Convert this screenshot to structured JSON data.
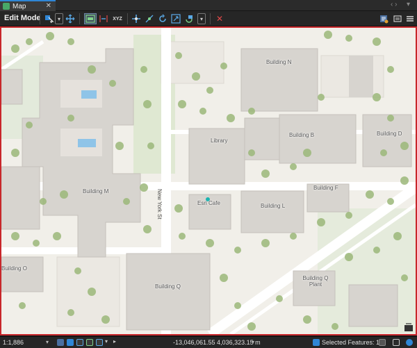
{
  "tab": {
    "title": "Map",
    "close": "✕"
  },
  "window": {
    "nav": "‹ ›",
    "menu": "▾"
  },
  "toolbar": {
    "mode_label": "Edit Mode",
    "xyz": "XYZ",
    "dropdown": "▾",
    "delete": "✕",
    "icons": [
      "select-icon",
      "move-icon",
      "annotation-edit-icon",
      "vertices-icon",
      "xyz-icon",
      "transform-icon",
      "reshape-icon",
      "rotate-icon",
      "scale-icon",
      "attributes-icon",
      "delete-icon",
      "list-icon",
      "menu-icon"
    ]
  },
  "map": {
    "labels": {
      "building_n": "Building N",
      "library": "Library",
      "building_b": "Building B",
      "building_d": "Building D",
      "building_m": "Building M",
      "building_f": "Building F",
      "esri_cafe": "Esri Cafe",
      "building_l": "Building L",
      "building_o": "Building O",
      "building_q": "Building Q",
      "building_q_plant": "Building Q Plant",
      "new_york_st": "New York St"
    },
    "colors": {
      "selection_border": "#c8262a",
      "ground": "#f1efe9",
      "building": "#d7d4cf",
      "tree": "#9cb87a",
      "point": "#1ab4b0"
    }
  },
  "construction_toolbar": {
    "tools": [
      "point-tool-icon",
      "line-midpoint-tool-icon",
      "finish-sketch-icon",
      "cancel-sketch-icon",
      "settings-icon"
    ]
  },
  "status": {
    "scale": "1:1,886",
    "scale_dropdown": "▾",
    "coordinates": "-13,046,061.55 4,036,323.15 m",
    "coord_dropdown": "▾",
    "selected_features": "Selected Features: 1"
  }
}
